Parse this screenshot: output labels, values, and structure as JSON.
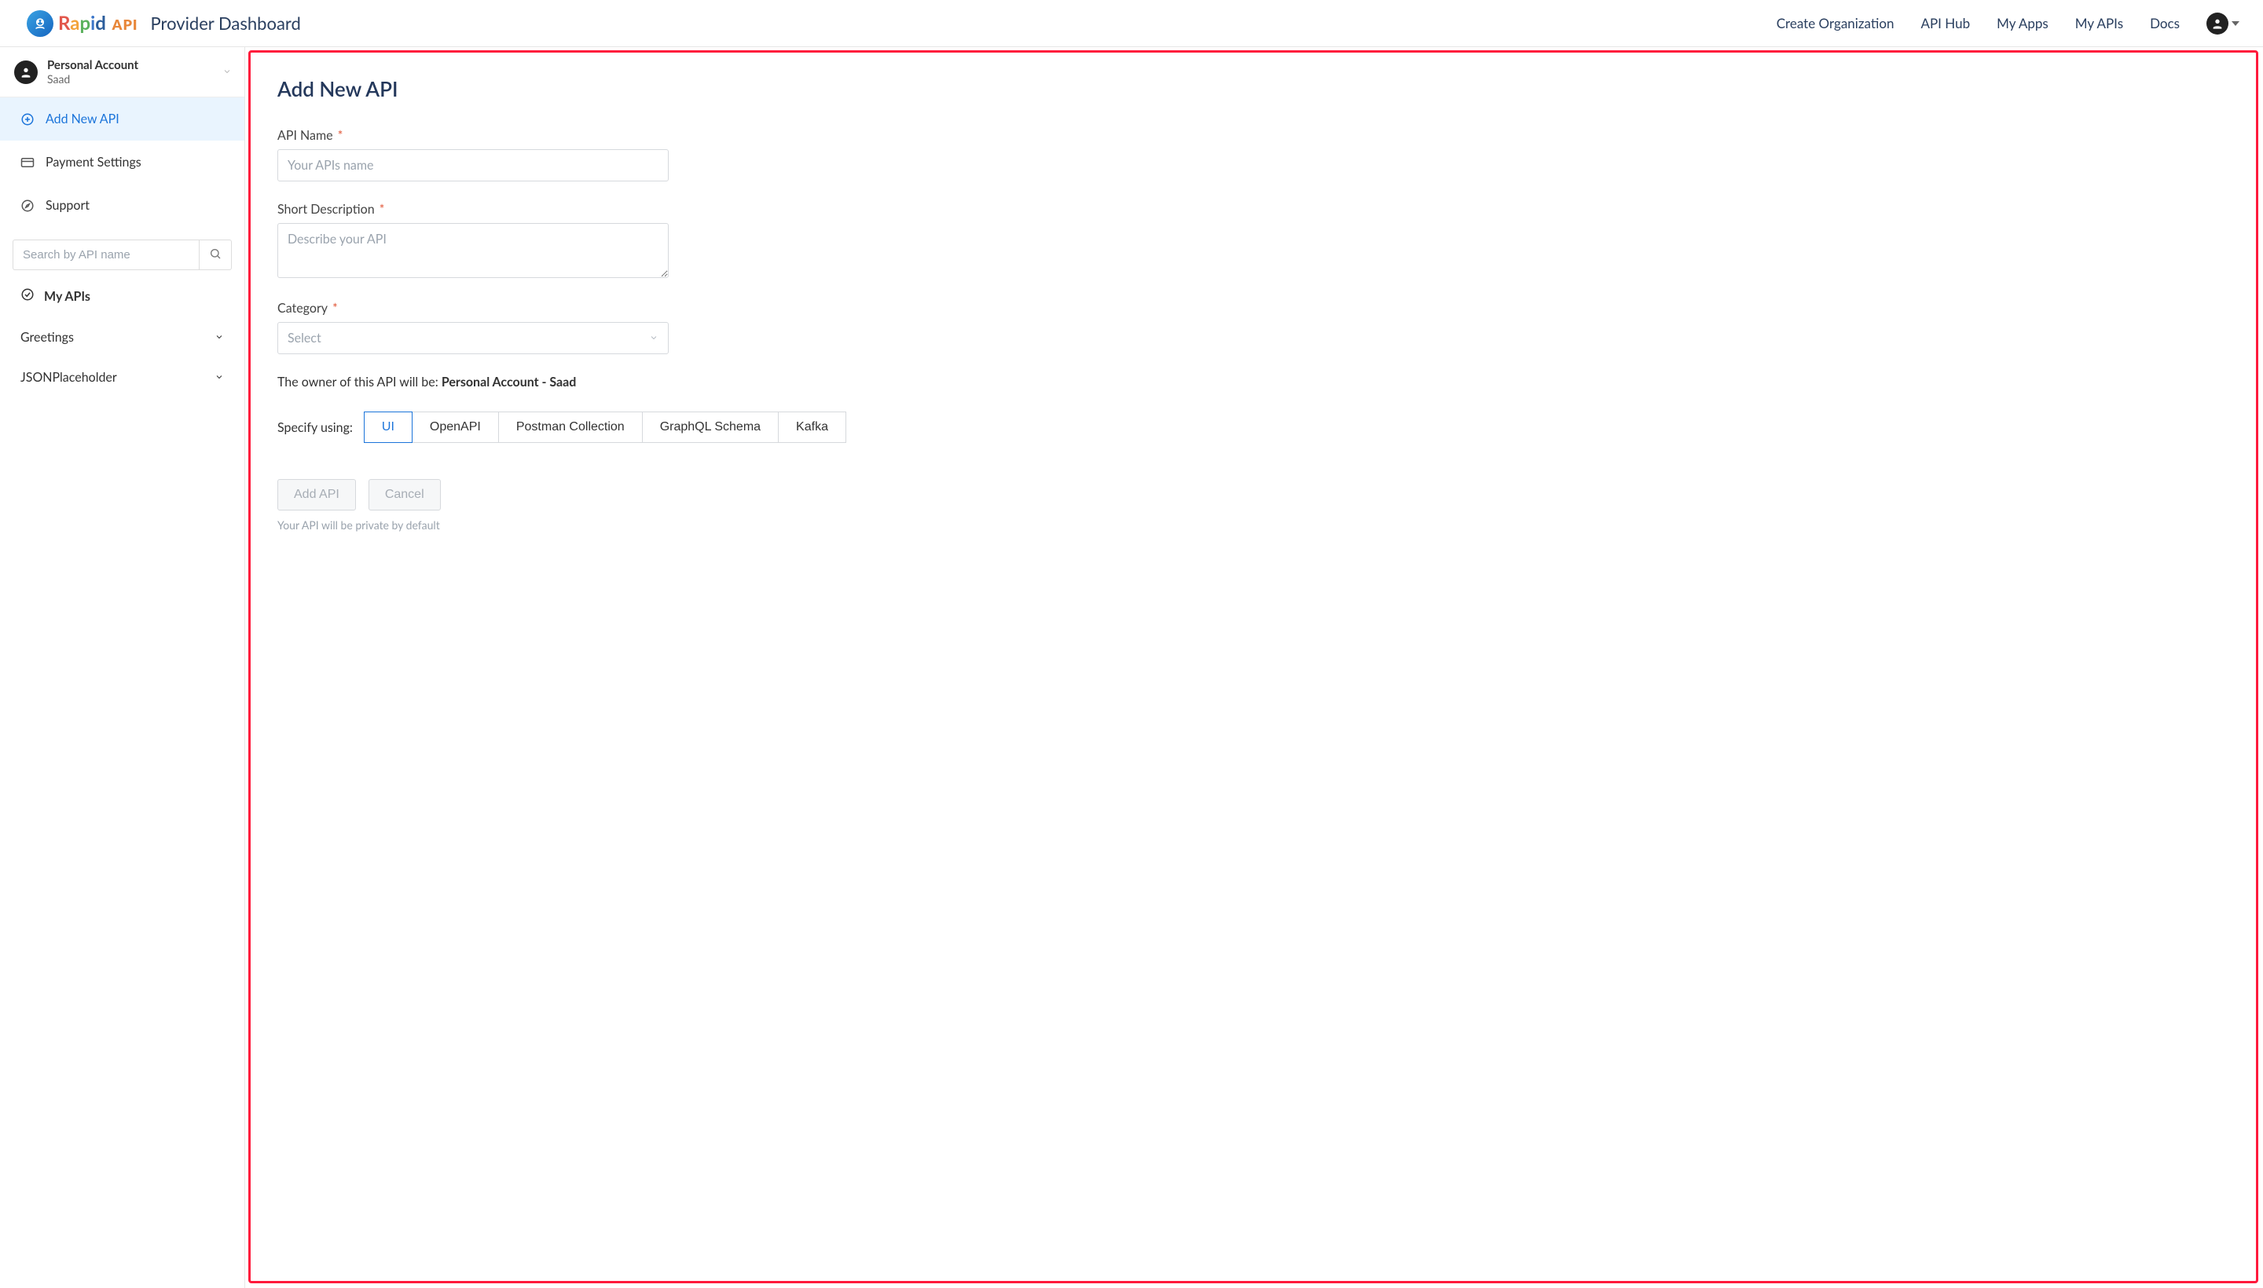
{
  "header": {
    "brand_segments": [
      "R",
      "a",
      "p",
      "i",
      "d"
    ],
    "brand_suffix": "API",
    "dashboard_title": "Provider Dashboard",
    "nav": {
      "create_org": "Create Organization",
      "api_hub": "API Hub",
      "my_apps": "My Apps",
      "my_apis": "My APIs",
      "docs": "Docs"
    }
  },
  "sidebar": {
    "account": {
      "type_label": "Personal Account",
      "username": "Saad"
    },
    "items": {
      "add_new_api": "Add New API",
      "payment_settings": "Payment Settings",
      "support": "Support"
    },
    "search_placeholder": "Search by API name",
    "my_apis_label": "My APIs",
    "apis": [
      {
        "name": "Greetings"
      },
      {
        "name": "JSONPlaceholder"
      }
    ]
  },
  "main": {
    "page_title": "Add New API",
    "fields": {
      "api_name": {
        "label": "API Name",
        "placeholder": "Your APIs name",
        "value": ""
      },
      "short_desc": {
        "label": "Short Description",
        "placeholder": "Describe your API",
        "value": ""
      },
      "category": {
        "label": "Category",
        "placeholder": "Select",
        "value": ""
      }
    },
    "owner_prefix": "The owner of this API will be: ",
    "owner_value": "Personal Account - Saad",
    "specify_label": "Specify using:",
    "specify_options": [
      "UI",
      "OpenAPI",
      "Postman Collection",
      "GraphQL Schema",
      "Kafka"
    ],
    "specify_selected": "UI",
    "actions": {
      "add": "Add API",
      "cancel": "Cancel"
    },
    "private_hint": "Your API will be private by default"
  },
  "required_marker": "*"
}
